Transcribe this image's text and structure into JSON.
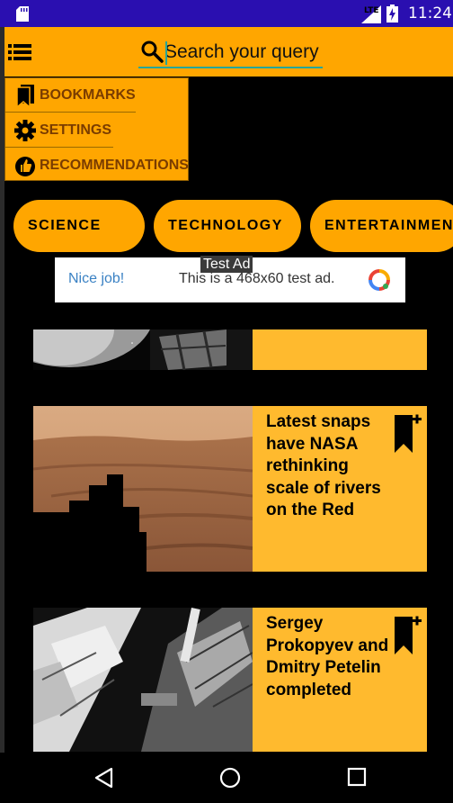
{
  "status_bar": {
    "time": "11:24",
    "network": "LTE"
  },
  "app_bar": {
    "search": {
      "placeholder": "Search your query",
      "value": ""
    }
  },
  "menu": {
    "items": [
      {
        "label": "BOOKMARKS",
        "icon": "bookmark-icon"
      },
      {
        "label": "SETTINGS",
        "icon": "gear-icon"
      },
      {
        "label": "RECOMMENDATIONS",
        "icon": "thumbs-up-icon"
      }
    ]
  },
  "categories": [
    "SCIENCE",
    "TECHNOLOGY",
    "ENTERTAINMENT"
  ],
  "ad": {
    "tag": "Test Ad",
    "headline": "Nice job!",
    "text": "This is a 468x60 test ad."
  },
  "articles": [
    {
      "title": "",
      "image": "moon-and-satellite"
    },
    {
      "title": "Latest snaps have NASA rethinking scale of rivers on the Red",
      "image": "mars-surface"
    },
    {
      "title": "Sergey Prokopyev and Dmitry Petelin completed",
      "image": "space-station"
    }
  ],
  "colors": {
    "primary": "#ffa600",
    "card": "#ffba2e",
    "status_bar": "#2a0fb0",
    "accent": "#26a69a"
  }
}
